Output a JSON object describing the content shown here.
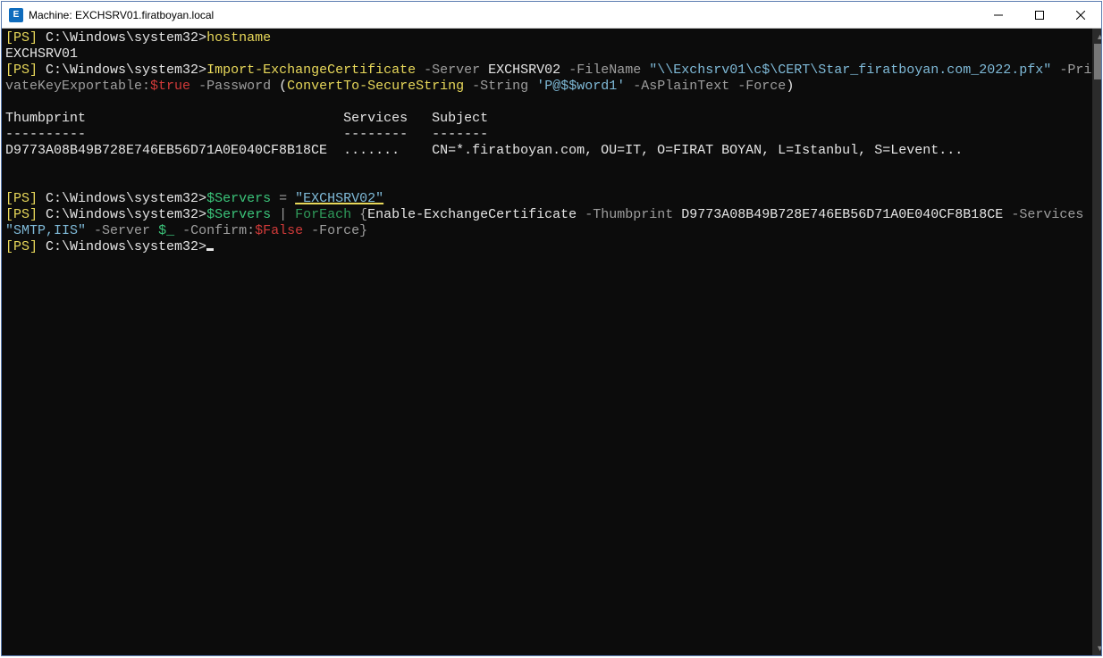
{
  "window": {
    "icon_letter": "E",
    "title": "Machine: EXCHSRV01.firatboyan.local"
  },
  "prompt": {
    "ps": "[PS]",
    "path": "C:\\Windows\\system32>"
  },
  "line1": {
    "cmd": "hostname"
  },
  "line2": {
    "output": "EXCHSRV01"
  },
  "line3": {
    "cmd": "Import-ExchangeCertificate",
    "p_server": "-Server",
    "v_server": "EXCHSRV02",
    "p_file": "-FileName",
    "v_file": "\"\\\\Exchsrv01\\c$\\CERT\\Star_firatboyan.com_2022.pfx\"",
    "p_pke": "-PrivateKeyExportable:",
    "v_pke": "$true",
    "p_pass": "-Password",
    "lparen": "(",
    "cmd2": "ConvertTo-SecureString",
    "p_str": "-String",
    "v_str": "'P@$$word1'",
    "p_plain": "-AsPlainText",
    "p_force": "-Force",
    "rparen": ")"
  },
  "table": {
    "h1": "Thumbprint",
    "h2": "Services",
    "h3": "Subject",
    "d1": "----------",
    "d2": "--------",
    "d3": "-------",
    "r1c1": "D9773A08B49B728E746EB56D71A0E040CF8B18CE",
    "r1c2": ".......",
    "r1c3": "CN=*.firatboyan.com, OU=IT, O=FIRAT BOYAN, L=Istanbul, S=Levent..."
  },
  "line_assign": {
    "var": "$Servers",
    "eq": " = ",
    "val": "\"EXCHSRV02\""
  },
  "line_foreach": {
    "var": "$Servers",
    "pipe": " | ",
    "foreach": "ForEach",
    "lbrace": " {",
    "cmd": "Enable-ExchangeCertificate",
    "p_thumb": "-Thumbprint",
    "v_thumb": "D9773A08B49B728E746EB56D71A0E040CF8B18CE",
    "p_serv": "-Services",
    "v_serv": "\"SMTP,IIS\"",
    "p_server": "-Server",
    "v_server": "$_",
    "p_confirm": "-Confirm:",
    "v_confirm": "$False",
    "p_force": "-Force",
    "rbrace": "}"
  }
}
